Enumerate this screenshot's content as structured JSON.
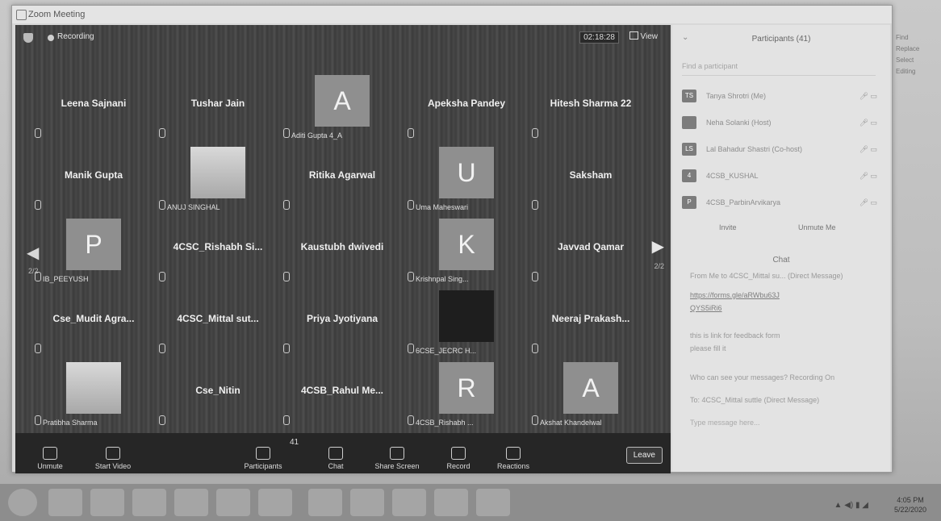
{
  "window": {
    "title": "Zoom Meeting"
  },
  "meeting": {
    "recording_label": "Recording",
    "timer": "02:18:28",
    "view_label": "View",
    "page_indicator": "2/2"
  },
  "tiles": [
    {
      "name": "Leena Sajnani",
      "avatar": null,
      "sub": ""
    },
    {
      "name": "Tushar Jain",
      "avatar": null,
      "sub": ""
    },
    {
      "name": "",
      "avatar": "A",
      "sub": "Aditi Gupta 4_A"
    },
    {
      "name": "Apeksha Pandey",
      "avatar": null,
      "sub": ""
    },
    {
      "name": "Hitesh Sharma 22",
      "avatar": null,
      "sub": ""
    },
    {
      "name": "Manik Gupta",
      "avatar": null,
      "sub": ""
    },
    {
      "name": "",
      "avatar": "photo",
      "sub": "ANUJ SINGHAL"
    },
    {
      "name": "Ritika Agarwal",
      "avatar": null,
      "sub": ""
    },
    {
      "name": "",
      "avatar": "U",
      "sub": "Uma Maheswari"
    },
    {
      "name": "Saksham",
      "avatar": null,
      "sub": ""
    },
    {
      "name": "",
      "avatar": "P",
      "sub": "IB_PEEYUSH"
    },
    {
      "name": "4CSC_Rishabh Si...",
      "avatar": null,
      "sub": ""
    },
    {
      "name": "Kaustubh dwivedi",
      "avatar": null,
      "sub": ""
    },
    {
      "name": "",
      "avatar": "K",
      "sub": "Krishnpal Sing..."
    },
    {
      "name": "Javvad Qamar",
      "avatar": null,
      "sub": ""
    },
    {
      "name": "Cse_Mudit Agra...",
      "avatar": null,
      "sub": ""
    },
    {
      "name": "4CSC_Mittal sut...",
      "avatar": null,
      "sub": ""
    },
    {
      "name": "Priya Jyotiyana",
      "avatar": null,
      "sub": ""
    },
    {
      "name": "",
      "avatar": "dark",
      "sub": "6CSE_JECRC H..."
    },
    {
      "name": "Neeraj Prakash...",
      "avatar": null,
      "sub": ""
    },
    {
      "name": "",
      "avatar": "photo",
      "sub": "Pratibha Sharma"
    },
    {
      "name": "Cse_Nitin",
      "avatar": null,
      "sub": ""
    },
    {
      "name": "4CSB_Rahul Me...",
      "avatar": null,
      "sub": ""
    },
    {
      "name": "",
      "avatar": "R",
      "sub": "4CSB_Rishabh ..."
    },
    {
      "name": "",
      "avatar": "A",
      "sub": "Akshat Khandelwal"
    }
  ],
  "toolbar": {
    "unmute": "Unmute",
    "start_video": "Start Video",
    "participants": "Participants",
    "participants_count": "41",
    "chat": "Chat",
    "share_screen": "Share Screen",
    "record": "Record",
    "reactions": "Reactions",
    "leave": "Leave"
  },
  "participants_panel": {
    "title": "Participants (41)",
    "search_placeholder": "Find a participant",
    "rows": [
      {
        "initials": "TS",
        "name": "Tanya Shrotri (Me)"
      },
      {
        "initials": "",
        "name": "Neha Solanki (Host)"
      },
      {
        "initials": "LS",
        "name": "Lal Bahadur Shastri (Co-host)"
      },
      {
        "initials": "4",
        "name": "4CSB_KUSHAL"
      },
      {
        "initials": "P",
        "name": "4CSB_ParbinArvikarya"
      }
    ],
    "invite": "Invite",
    "unmute_me": "Unmute Me"
  },
  "chat": {
    "title": "Chat",
    "from_line": "From Me to 4CSC_Mittal su... (Direct Message)",
    "link_line1": "https://forms.gle/aRWbu63J",
    "link_line2": "QYS5iRi6",
    "msg_line1": "this is link for feedback form",
    "msg_line2": "please fill it",
    "notice": "Who can see your messages? Recording On",
    "to_label": "To:",
    "to_target": "4CSC_Mittal suttle",
    "direct_message": "(Direct Message)",
    "input_placeholder": "Type message here..."
  },
  "desktop_side": {
    "items": [
      "Find",
      "Replace",
      "Select",
      "Editing"
    ]
  },
  "taskbar": {
    "time": "4:05 PM",
    "date": "5/22/2020"
  }
}
